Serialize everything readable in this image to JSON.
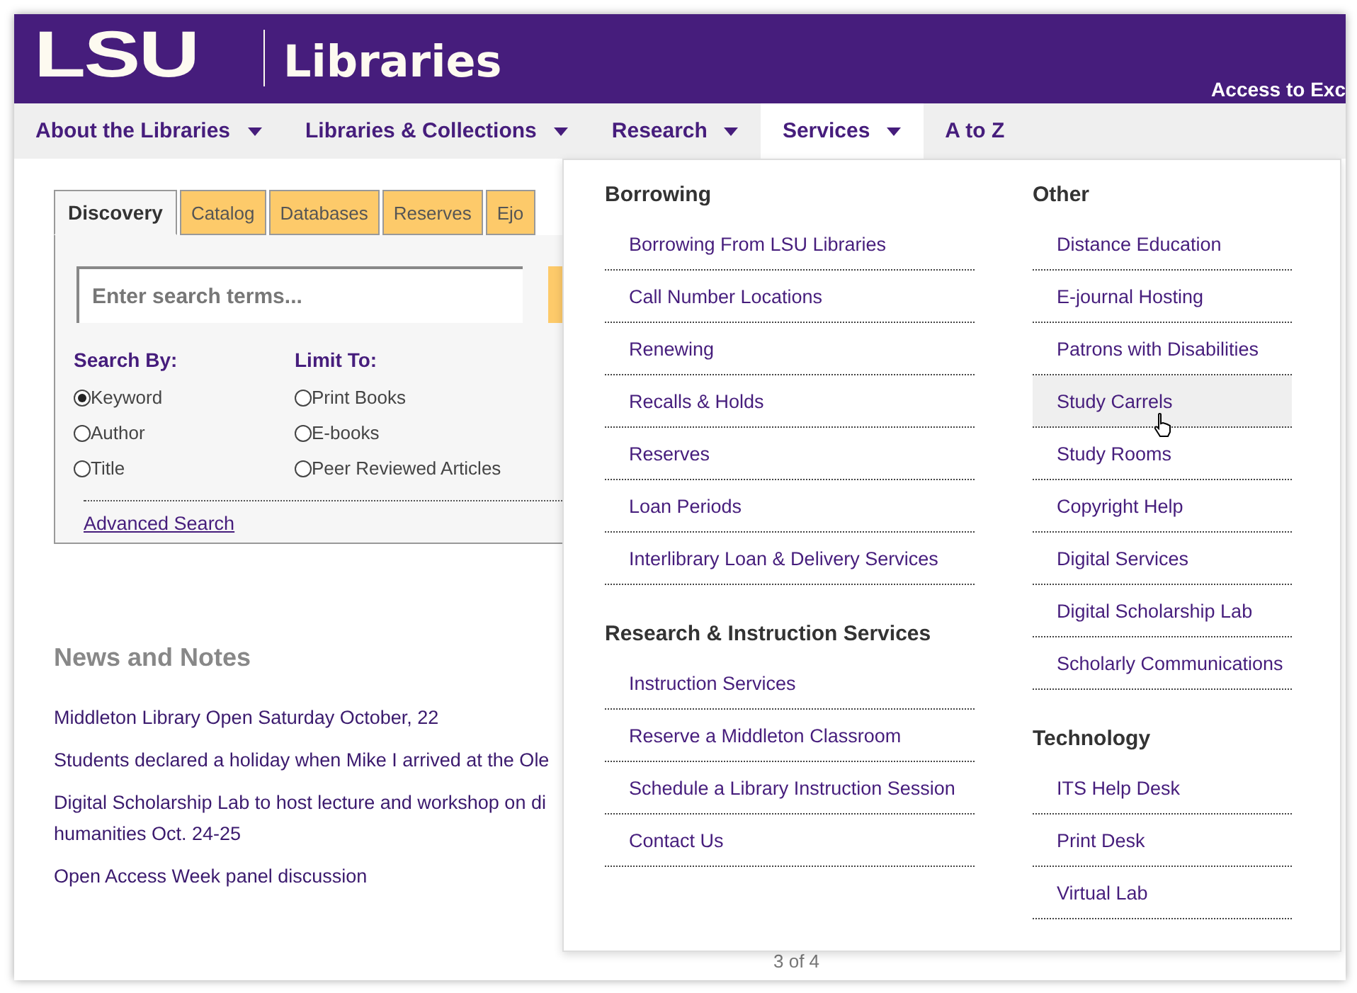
{
  "header": {
    "logo": "LSU",
    "title": "Libraries",
    "tagline": "Access to Exc"
  },
  "nav": [
    {
      "label": "About the Libraries",
      "has_menu": true,
      "selected": false
    },
    {
      "label": "Libraries & Collections",
      "has_menu": true,
      "selected": false
    },
    {
      "label": "Research",
      "has_menu": true,
      "selected": false
    },
    {
      "label": "Services",
      "has_menu": true,
      "selected": true
    },
    {
      "label": "A to Z",
      "has_menu": false,
      "selected": false
    }
  ],
  "search": {
    "tabs": [
      {
        "label": "Discovery",
        "selected": true
      },
      {
        "label": "Catalog",
        "selected": false
      },
      {
        "label": "Databases",
        "selected": false
      },
      {
        "label": "Reserves",
        "selected": false
      },
      {
        "label": "Ejo",
        "selected": false
      }
    ],
    "placeholder": "Enter search terms...",
    "groups": [
      {
        "label": "Search By:",
        "options": [
          {
            "label": "Keyword",
            "selected": true
          },
          {
            "label": "Author",
            "selected": false
          },
          {
            "label": "Title",
            "selected": false
          }
        ]
      },
      {
        "label": "Limit To:",
        "options": [
          {
            "label": "Print Books",
            "selected": false
          },
          {
            "label": "E-books",
            "selected": false
          },
          {
            "label": "Peer Reviewed Articles",
            "selected": false
          }
        ]
      }
    ],
    "advanced_link": "Advanced Search"
  },
  "news": {
    "heading": "News and Notes",
    "items": [
      "Middleton Library Open Saturday October, 22",
      "Students declared a holiday when Mike I arrived at the Ole",
      "Digital Scholarship Lab to host lecture and workshop on di\nhumanities Oct. 24-25",
      "Open Access Week panel discussion"
    ]
  },
  "pager": "3 of 4",
  "menu": {
    "columns": [
      [
        {
          "heading": "Borrowing",
          "items": [
            {
              "label": "Borrowing From LSU Libraries",
              "selected": false
            },
            {
              "label": "Call Number Locations",
              "selected": false
            },
            {
              "label": "Renewing",
              "selected": false
            },
            {
              "label": "Recalls & Holds",
              "selected": false
            },
            {
              "label": "Reserves",
              "selected": false
            },
            {
              "label": "Loan Periods",
              "selected": false
            },
            {
              "label": "Interlibrary Loan & Delivery Services",
              "selected": false
            }
          ]
        },
        {
          "heading": "Research & Instruction Services",
          "items": [
            {
              "label": "Instruction Services",
              "selected": false
            },
            {
              "label": "Reserve a Middleton Classroom",
              "selected": false
            },
            {
              "label": "Schedule a Library Instruction Session",
              "selected": false
            },
            {
              "label": "Contact Us",
              "selected": false
            }
          ]
        }
      ],
      [
        {
          "heading": "Other",
          "items": [
            {
              "label": "Distance Education",
              "selected": false
            },
            {
              "label": "E-journal Hosting",
              "selected": false
            },
            {
              "label": "Patrons with Disabilities",
              "selected": false
            },
            {
              "label": "Study Carrels",
              "selected": true
            },
            {
              "label": "Study Rooms",
              "selected": false
            },
            {
              "label": "Copyright Help",
              "selected": false
            },
            {
              "label": "Digital Services",
              "selected": false
            },
            {
              "label": "Digital Scholarship Lab",
              "selected": false
            },
            {
              "label": "Scholarly Communications",
              "selected": false
            }
          ]
        },
        {
          "heading": "Technology",
          "items": [
            {
              "label": "ITS Help Desk",
              "selected": false
            },
            {
              "label": "Print Desk",
              "selected": false
            },
            {
              "label": "Virtual Lab",
              "selected": false
            }
          ]
        }
      ]
    ]
  }
}
